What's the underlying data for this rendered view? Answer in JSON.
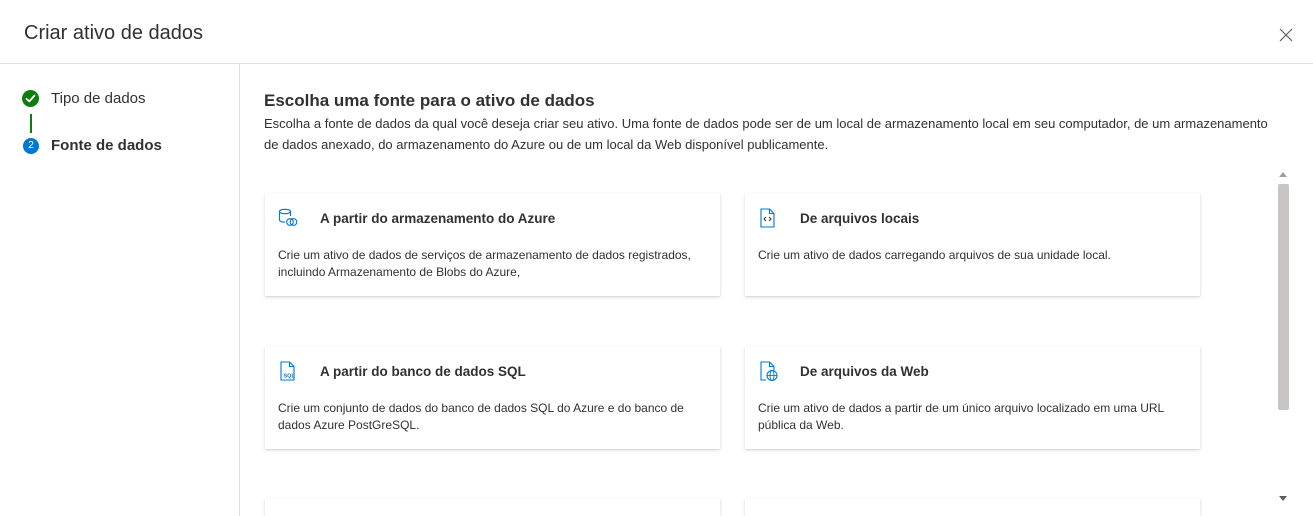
{
  "dialog": {
    "title": "Criar ativo de dados",
    "close_icon": "close-icon"
  },
  "steps": [
    {
      "label": "Tipo de dados",
      "status": "completed",
      "icon": "checkmark-icon",
      "color": "#107c10"
    },
    {
      "label": "Fonte de dados",
      "status": "current",
      "number": "2",
      "color": "#0078d4"
    }
  ],
  "main": {
    "title": "Escolha uma fonte para o ativo de dados",
    "description": "Escolha a fonte de dados da qual você deseja criar seu ativo. Uma fonte de dados pode ser de um local de armazenamento local em seu computador, de um armazenamento de dados anexado, do armazenamento do Azure ou de um local da Web disponível publicamente."
  },
  "cards": [
    {
      "title": "A partir do armazenamento do Azure",
      "description": "Crie um ativo de dados de serviços de armazenamento de dados registrados, incluindo Armazenamento de Blobs do Azure,",
      "icon": "azure-storage-icon"
    },
    {
      "title": "De arquivos locais",
      "description": "Crie um ativo de dados carregando arquivos de sua unidade local.",
      "icon": "local-file-icon"
    },
    {
      "title": "A partir do banco de dados SQL",
      "description": "Crie um conjunto de dados do banco de dados SQL do Azure e do banco de dados Azure PostGreSQL.",
      "icon": "sql-file-icon"
    },
    {
      "title": "De arquivos da Web",
      "description": "Crie um ativo de dados a partir de um único arquivo localizado em uma URL pública da Web.",
      "icon": "web-file-icon"
    }
  ],
  "colors": {
    "accent": "#0078d4",
    "success": "#107c10",
    "text": "#323130",
    "border": "#e1dfdd"
  }
}
